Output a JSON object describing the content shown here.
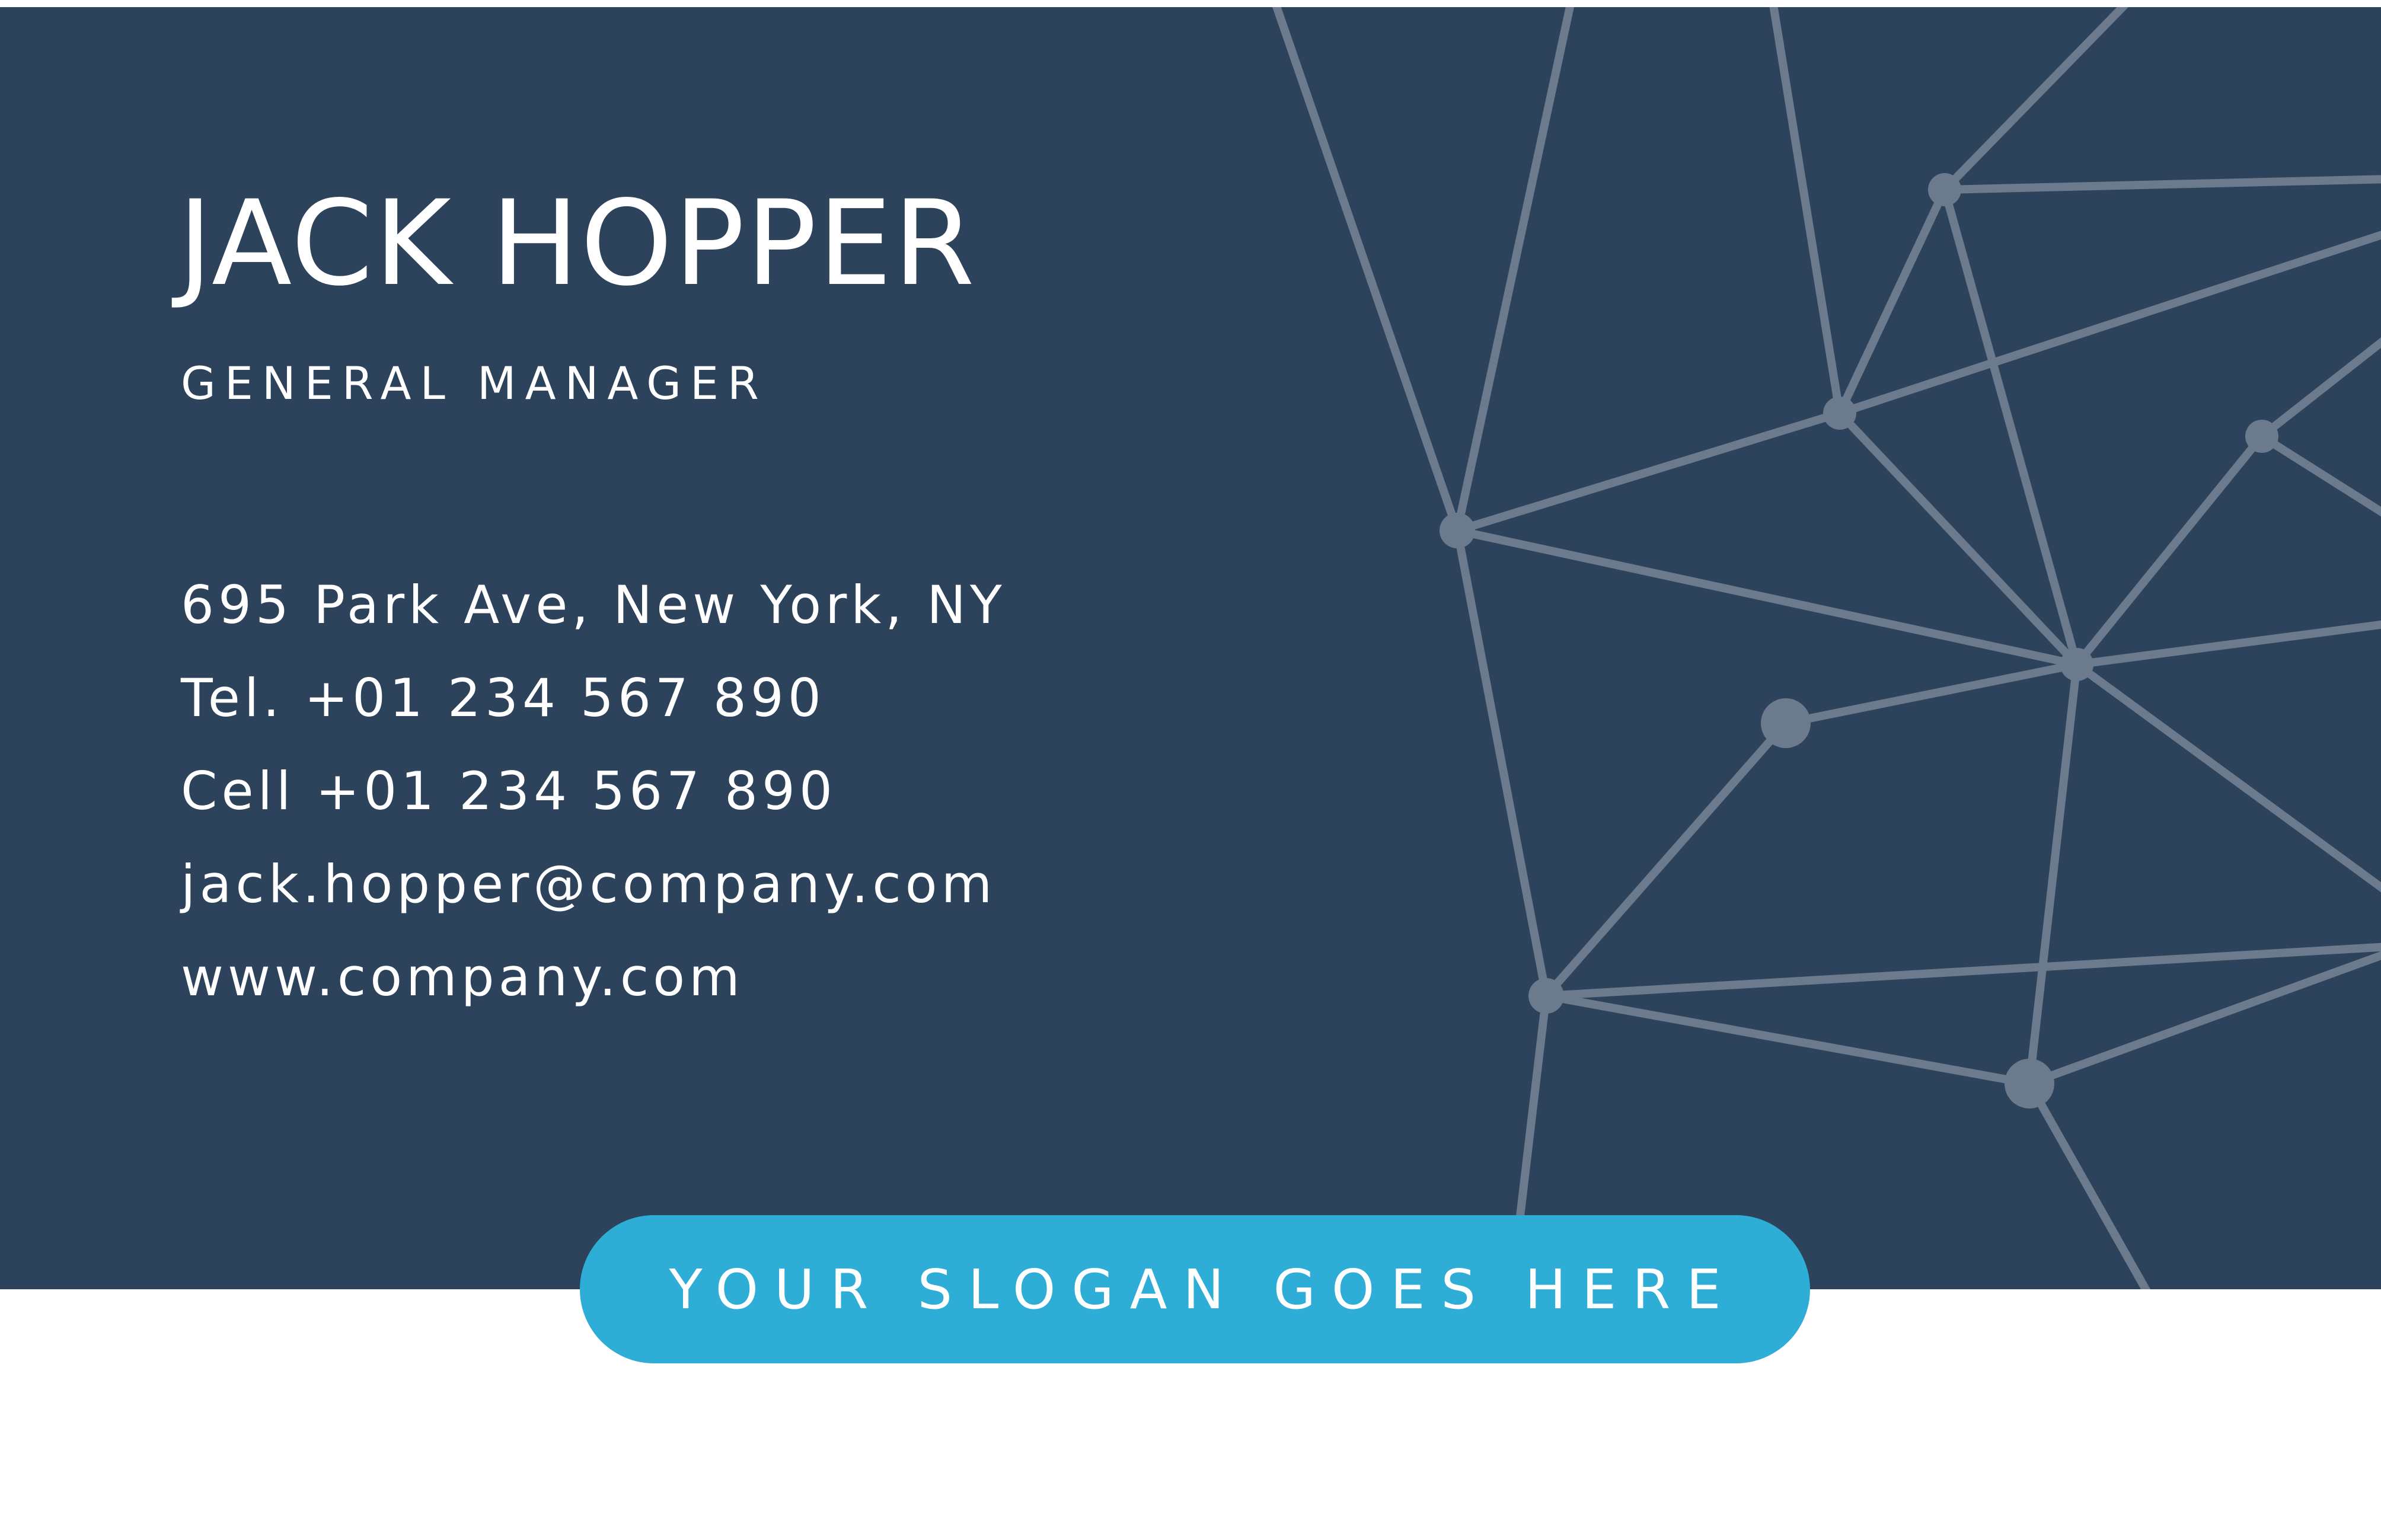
{
  "card": {
    "name": "JACK HOPPER",
    "job_title": "GENERAL MANAGER",
    "contact": {
      "address": "695 Park Ave, New York, NY",
      "telephone": "Tel. +01 234 567 890",
      "cell": "Cell +01 234 567 890",
      "email": "jack.hopper@company.com",
      "website": "www.company.com"
    },
    "slogan": "YOUR SLOGAN GOES HERE"
  },
  "colors": {
    "panel_background": "#2d425b",
    "network_lines": "#6b7b8d",
    "slogan_pill": "#2eadd6",
    "text": "#ffffff",
    "page_background": "#ffffff"
  }
}
